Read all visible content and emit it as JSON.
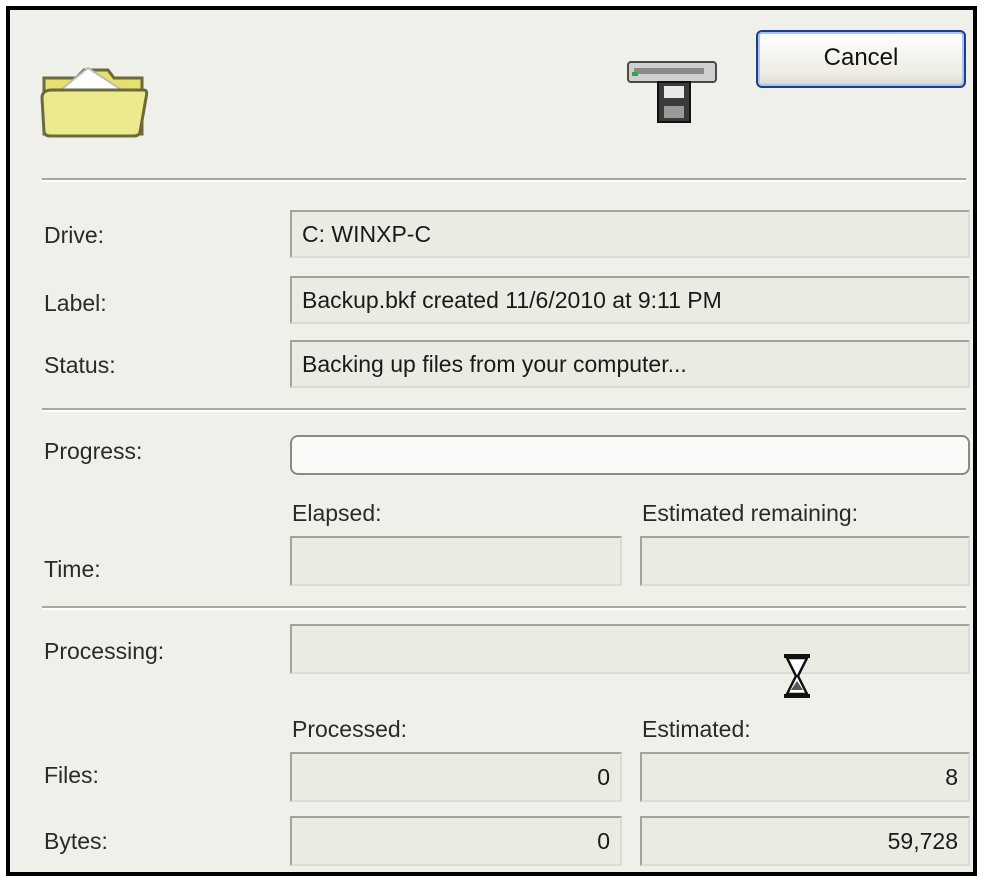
{
  "header": {
    "cancel_label": "Cancel"
  },
  "icons": {
    "folder": "folder-icon",
    "drive": "backup-drive-icon",
    "busy": "hourglass-icon"
  },
  "info": {
    "drive_label": "Drive:",
    "drive_value": "C: WINXP-C",
    "label_label": "Label:",
    "label_value": "Backup.bkf created  11/6/2010  at 9:11 PM",
    "status_label": "Status:",
    "status_value": "Backing up files from your computer..."
  },
  "progress": {
    "label": "Progress:",
    "percent": 0
  },
  "time": {
    "label": "Time:",
    "elapsed_label": "Elapsed:",
    "remaining_label": "Estimated remaining:",
    "elapsed_value": "",
    "remaining_value": ""
  },
  "processing": {
    "label": "Processing:",
    "value": "",
    "processed_label": "Processed:",
    "estimated_label": "Estimated:",
    "files_label": "Files:",
    "files_processed": "0",
    "files_estimated": "8",
    "bytes_label": "Bytes:",
    "bytes_processed": "0",
    "bytes_estimated": "59,728"
  },
  "colors": {
    "button_border": "#1b3f8a",
    "progress_fill": "#2ea84a",
    "folder": "#e6e070"
  }
}
